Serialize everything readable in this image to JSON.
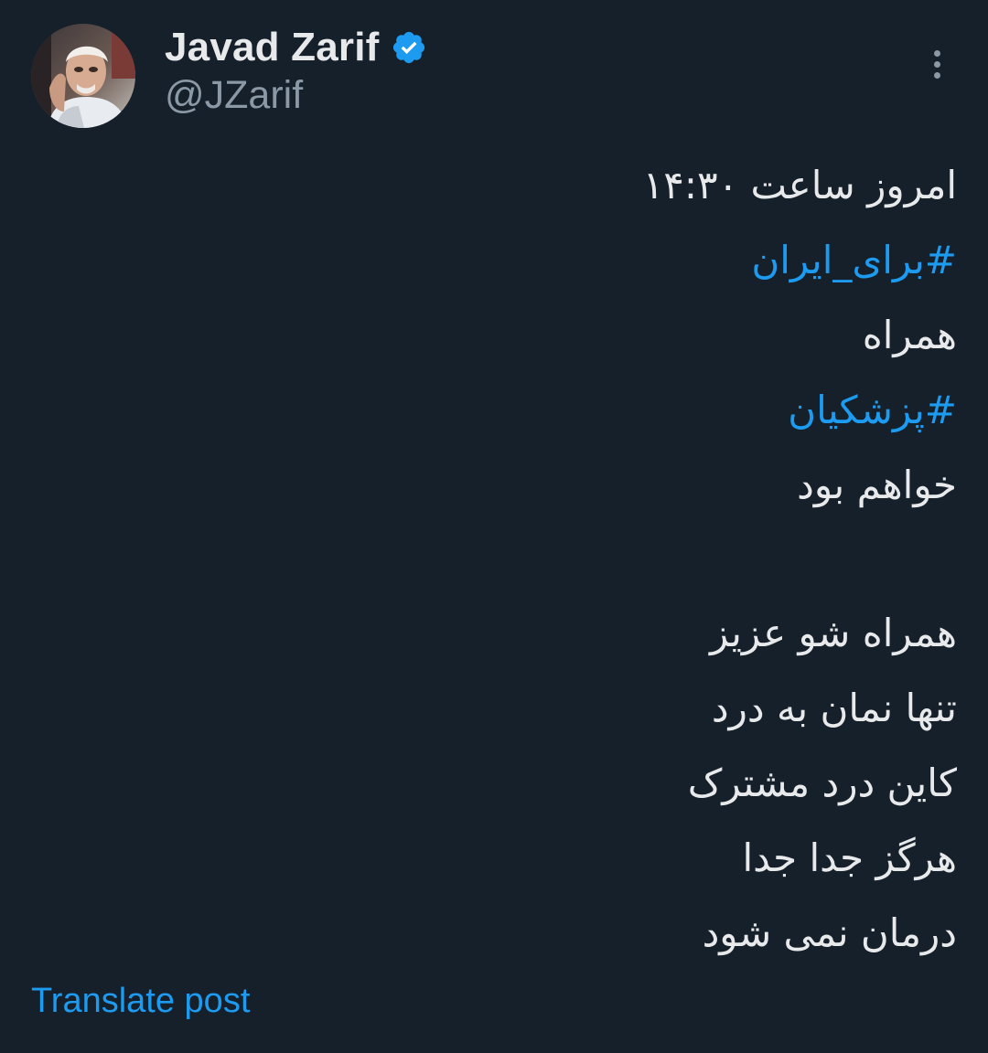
{
  "author": {
    "display_name": "Javad Zarif",
    "handle": "@JZarif",
    "verified_icon": "verified-badge-icon",
    "avatar": "profile-photo"
  },
  "menu": {
    "icon": "more-vertical-icon"
  },
  "post": {
    "lines": [
      "امروز ساعت ۱۴:۳۰",
      "#برای_ایران",
      "همراه",
      "#پزشکیان",
      "خواهم بود",
      "",
      "همراه شو عزیز",
      "تنها نمان به درد",
      "کاین درد مشترک",
      "هرگز جدا جدا",
      "درمان نمی شود"
    ]
  },
  "translate_label": "Translate post",
  "colors": {
    "background": "#16202b",
    "text": "#e7e9ea",
    "secondary": "#8b98a5",
    "accent": "#1d9bf0"
  }
}
